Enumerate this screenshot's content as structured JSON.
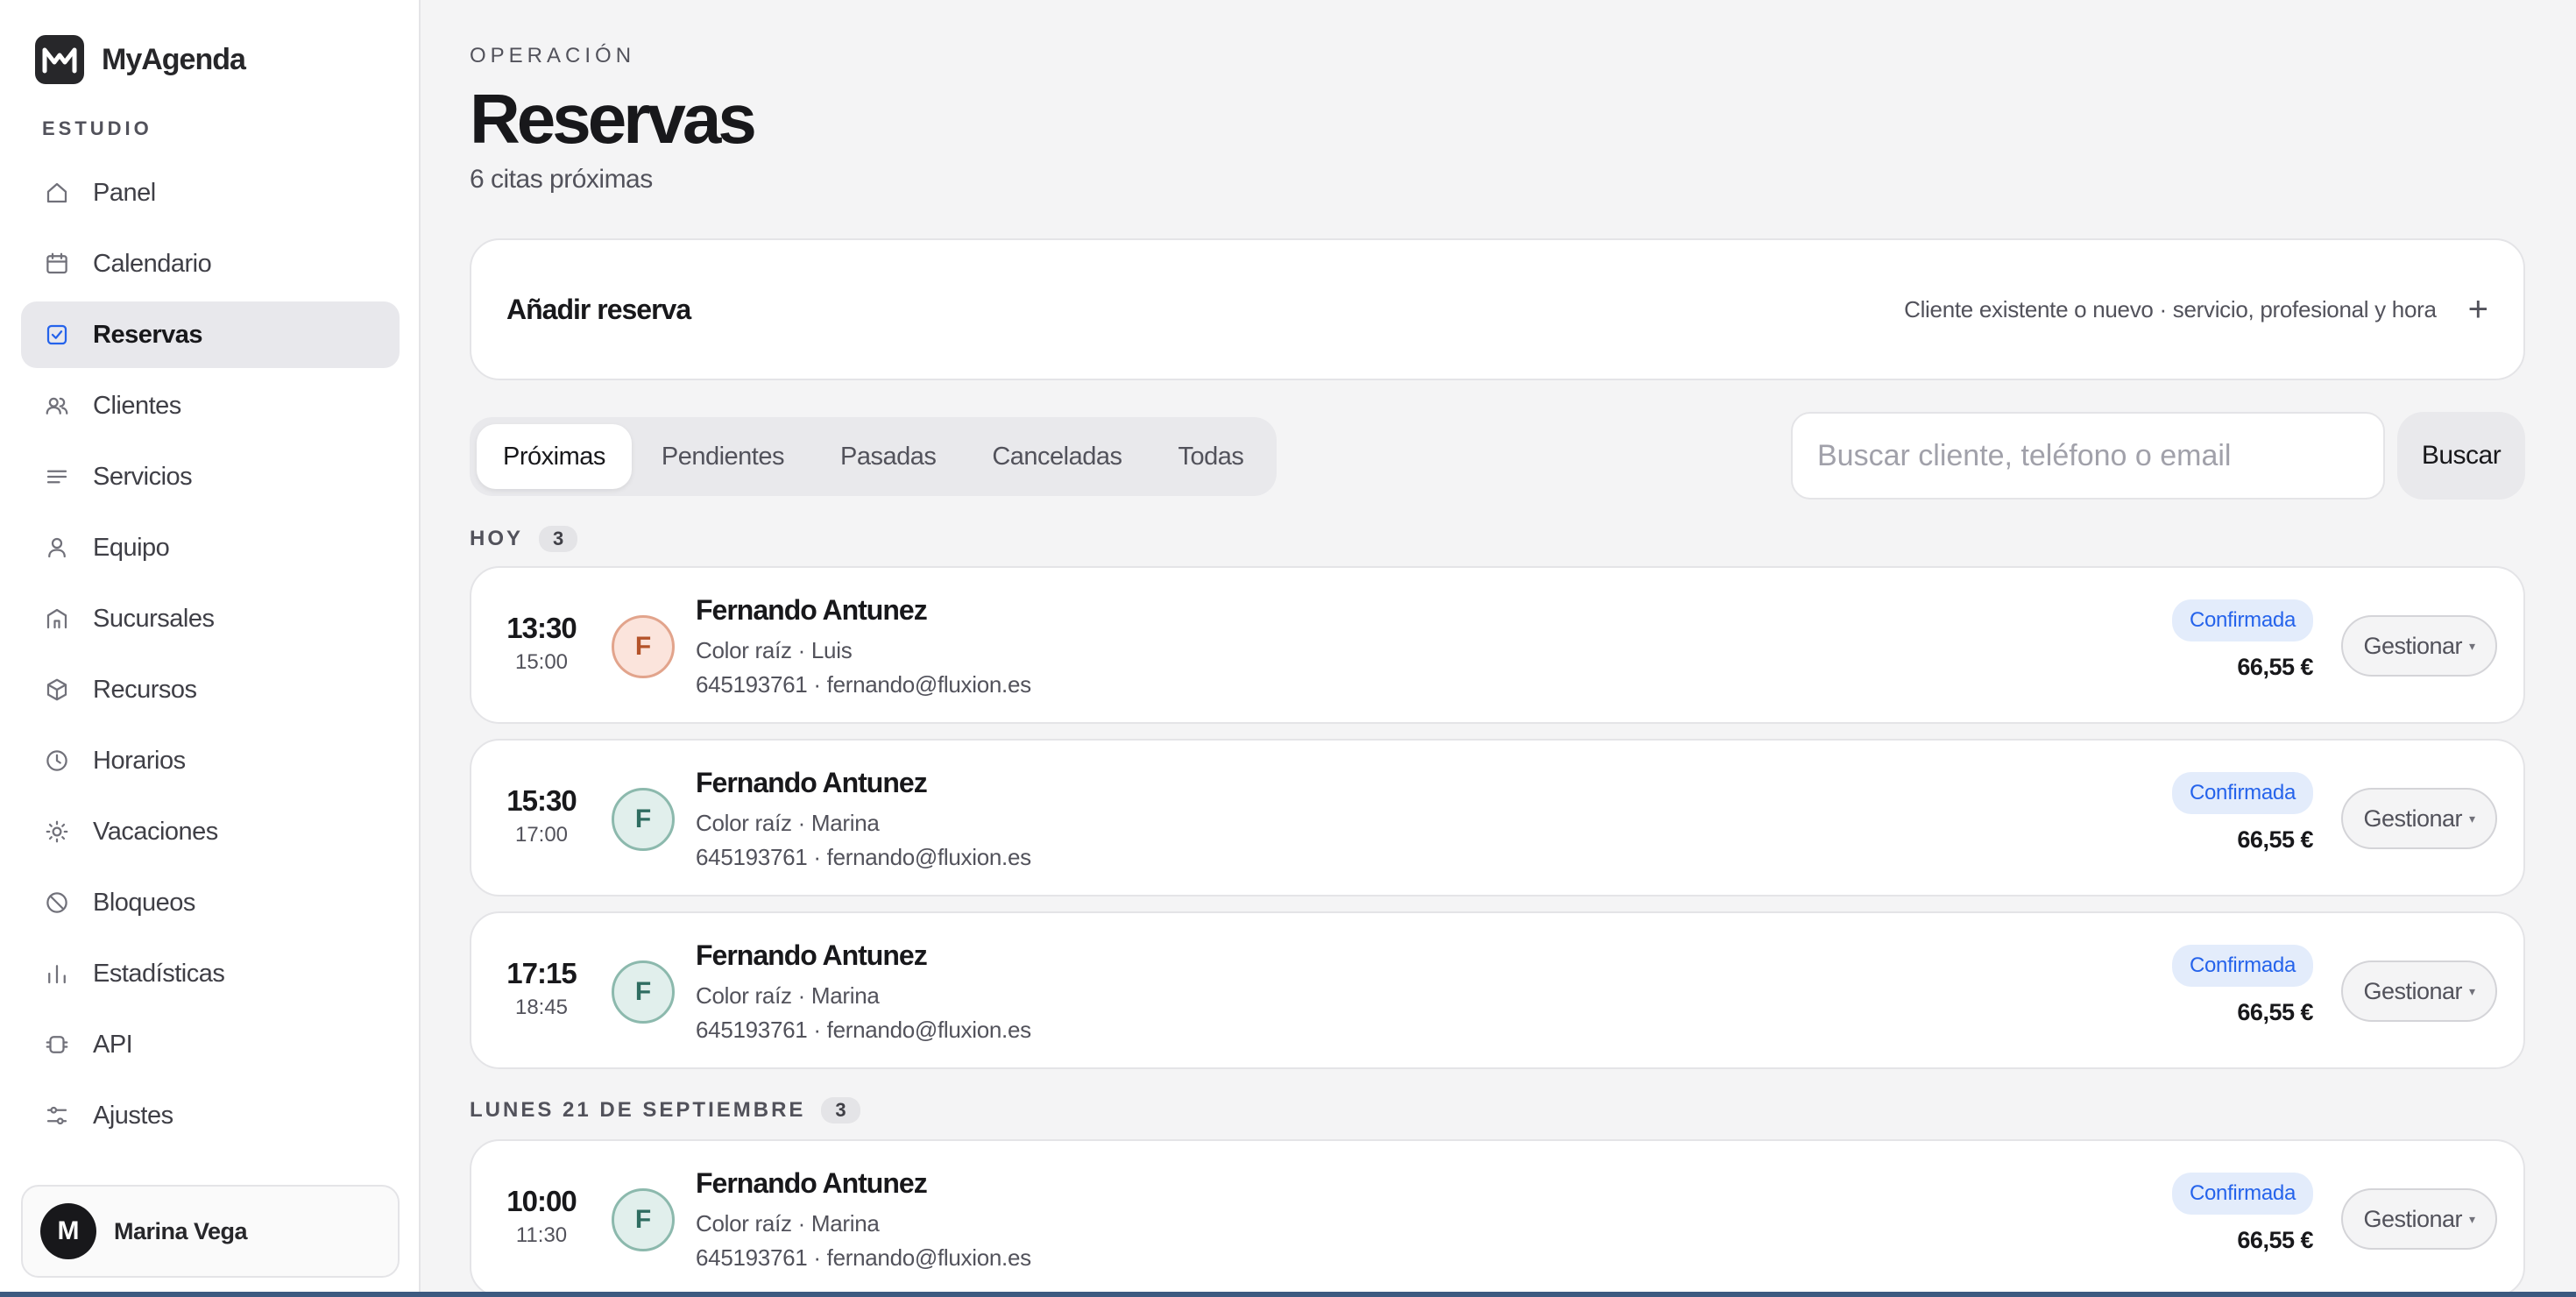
{
  "brand": {
    "name": "MyAgenda"
  },
  "sidebar": {
    "section": "ESTUDIO",
    "items": [
      {
        "label": "Panel",
        "icon": "home-icon"
      },
      {
        "label": "Calendario",
        "icon": "calendar-icon"
      },
      {
        "label": "Reservas",
        "icon": "checkbox-icon",
        "active": true
      },
      {
        "label": "Clientes",
        "icon": "users-icon"
      },
      {
        "label": "Servicios",
        "icon": "list-icon"
      },
      {
        "label": "Equipo",
        "icon": "user-icon"
      },
      {
        "label": "Sucursales",
        "icon": "building-icon"
      },
      {
        "label": "Recursos",
        "icon": "box-icon"
      },
      {
        "label": "Horarios",
        "icon": "clock-icon"
      },
      {
        "label": "Vacaciones",
        "icon": "sun-icon"
      },
      {
        "label": "Bloqueos",
        "icon": "block-icon"
      },
      {
        "label": "Estadísticas",
        "icon": "bar-chart-icon"
      },
      {
        "label": "API",
        "icon": "api-icon"
      },
      {
        "label": "Ajustes",
        "icon": "sliders-icon"
      }
    ],
    "user": {
      "initial": "M",
      "name": "Marina Vega"
    }
  },
  "header": {
    "eyebrow": "OPERACIÓN",
    "title": "Reservas",
    "subtitle": "6 citas próximas"
  },
  "add_booking": {
    "title": "Añadir reserva",
    "hint": "Cliente existente o nuevo · servicio, profesional y hora",
    "plus": "+"
  },
  "tabs": [
    "Próximas",
    "Pendientes",
    "Pasadas",
    "Canceladas",
    "Todas"
  ],
  "active_tab": "Próximas",
  "search": {
    "placeholder": "Buscar cliente, teléfono o email",
    "button": "Buscar"
  },
  "groups": [
    {
      "label": "HOY",
      "count": "3",
      "bookings": [
        {
          "start": "13:30",
          "end": "15:00",
          "initial": "F",
          "name": "Fernando Antunez",
          "service": "Color raíz · Luis",
          "contact": "645193761 · fernando@fluxion.es",
          "status": "Confirmada",
          "price": "66,55 €",
          "action": "Gestionar"
        },
        {
          "start": "15:30",
          "end": "17:00",
          "initial": "F",
          "name": "Fernando Antunez",
          "service": "Color raíz · Marina",
          "contact": "645193761 · fernando@fluxion.es",
          "status": "Confirmada",
          "price": "66,55 €",
          "action": "Gestionar"
        },
        {
          "start": "17:15",
          "end": "18:45",
          "initial": "F",
          "name": "Fernando Antunez",
          "service": "Color raíz · Marina",
          "contact": "645193761 · fernando@fluxion.es",
          "status": "Confirmada",
          "price": "66,55 €",
          "action": "Gestionar"
        }
      ]
    },
    {
      "label": "LUNES 21 DE SEPTIEMBRE",
      "count": "3",
      "bookings": [
        {
          "start": "10:00",
          "end": "11:30",
          "initial": "F",
          "name": "Fernando Antunez",
          "service": "Color raíz · Marina",
          "contact": "645193761 · fernando@fluxion.es",
          "status": "Confirmada",
          "price": "66,55 €",
          "action": "Gestionar"
        }
      ]
    }
  ],
  "colors": {
    "accent": "#2563eb",
    "status_bg": "#e3ecfb",
    "avatar_warm": "#fbe4dc",
    "avatar_cool": "#e1efec"
  }
}
